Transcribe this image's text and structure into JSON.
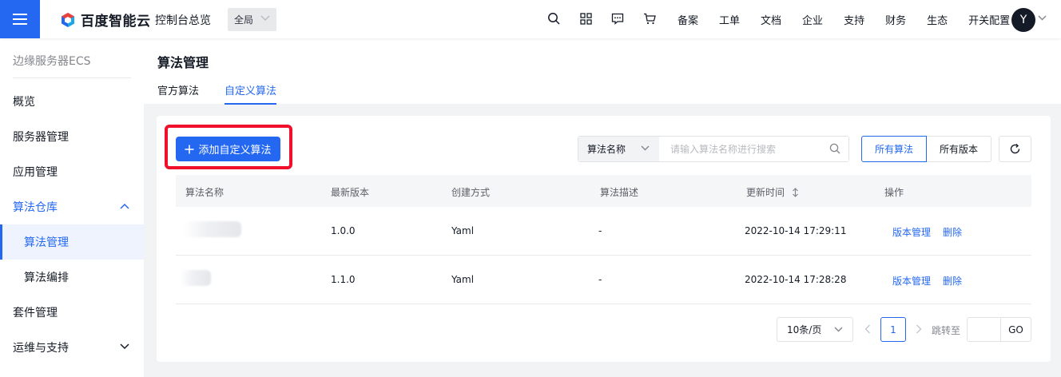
{
  "topbar": {
    "brand": "百度智能云",
    "console_title": "控制台总览",
    "region": "全局",
    "nav": [
      "备案",
      "工单",
      "文档",
      "企业",
      "支持",
      "财务",
      "生态",
      "开关配置"
    ],
    "avatar_letter": "Y",
    "icons": [
      "search-icon",
      "grid-icon",
      "message-icon",
      "cart-icon"
    ]
  },
  "sidebar": {
    "title": "边缘服务器ECS",
    "items": [
      {
        "label": "概览"
      },
      {
        "label": "服务器管理"
      },
      {
        "label": "应用管理"
      },
      {
        "label": "算法仓库",
        "expanded": true
      },
      {
        "label": "算法管理",
        "active": true
      },
      {
        "label": "算法编排"
      },
      {
        "label": "套件管理"
      },
      {
        "label": "运维与支持",
        "expanded": false
      }
    ]
  },
  "page": {
    "title": "算法管理",
    "tabs": [
      {
        "label": "官方算法"
      },
      {
        "label": "自定义算法",
        "active": true
      }
    ]
  },
  "toolbar": {
    "add_label": "添加自定义算法",
    "search_field": "算法名称",
    "search_placeholder": "请输入算法名称进行搜索",
    "filter_all_algo": "所有算法",
    "filter_all_version": "所有版本"
  },
  "table": {
    "columns": [
      "算法名称",
      "最新版本",
      "创建方式",
      "算法描述",
      "更新时间",
      "操作"
    ],
    "rows": [
      {
        "name": "",
        "version": "1.0.0",
        "method": "Yaml",
        "desc": "-",
        "updated": "2022-10-14 17:29:11",
        "action_manage": "版本管理",
        "action_delete": "删除"
      },
      {
        "name": "",
        "version": "1.1.0",
        "method": "Yaml",
        "desc": "-",
        "updated": "2022-10-14 17:28:28",
        "action_manage": "版本管理",
        "action_delete": "删除"
      }
    ]
  },
  "pagination": {
    "page_size": "10条/页",
    "current_page": "1",
    "jump_label": "跳转至",
    "go_label": "GO"
  },
  "colors": {
    "primary": "#2468f2",
    "highlight": "#f0102b"
  }
}
